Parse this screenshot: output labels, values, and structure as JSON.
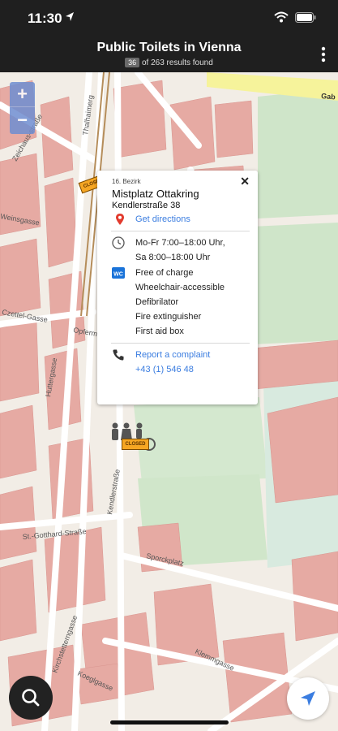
{
  "status_bar": {
    "time": "11:30"
  },
  "header": {
    "title": "Public Toilets in Vienna",
    "shown_count": "36",
    "subtitle_rest": "of 263 results found"
  },
  "map": {
    "zoom_in_label": "+",
    "zoom_out_label": "−",
    "closed_label": "CLOSED",
    "streets": [
      "Zeichaus-straße",
      "Weinsgasse",
      "Czettel-Gasse",
      "Opferm",
      "Thalhaimerg",
      "Huttergasse",
      "Kendlerstraße",
      "St.-Gotthard-Straße",
      "Sporckplatz",
      "Kendlerstraße",
      "Kirchstetterngasse",
      "Klemmgasse",
      "Koeglgasse",
      "Gab"
    ]
  },
  "popup": {
    "close_label": "✕",
    "district": "16. Bezirk",
    "name": "Mistplatz Ottakring",
    "address": "Kendlerstraße 38",
    "directions_label": "Get directions",
    "hours": [
      "Mo-Fr 7:00–18:00 Uhr,",
      "Sa 8:00–18:00 Uhr"
    ],
    "wc_icon_label": "WC",
    "features": [
      "Free of charge",
      "Wheelchair-accessible",
      "Defibrilator",
      "Fire extinguisher",
      "First aid box"
    ],
    "complaint_label": "Report a complaint",
    "phone": "+43 (1) 546 48"
  },
  "colors": {
    "header_bg": "#1f1f1f",
    "link": "#3b7de0",
    "closed_sign": "#f6a623",
    "building": "#e8a8a0",
    "green": "#cfe5c9"
  }
}
